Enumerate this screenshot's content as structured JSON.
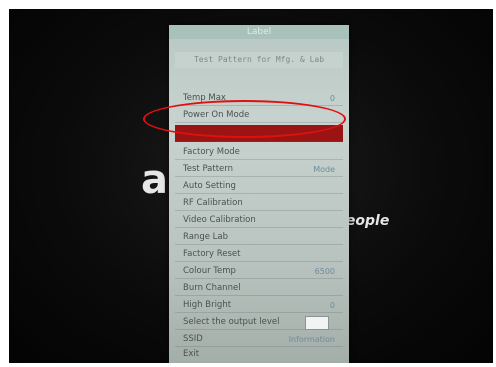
{
  "menu": {
    "title": "Label",
    "subtitle": "Test Pattern for Mfg. & Lab",
    "items": [
      {
        "label": "Temp Max",
        "value": "0"
      },
      {
        "label": "Power On Mode",
        "value": ""
      },
      {
        "label": "",
        "value": ""
      },
      {
        "label": "Factory Mode",
        "value": ""
      },
      {
        "label": "Test Pattern",
        "value": "Mode"
      },
      {
        "label": "Auto Setting",
        "value": ""
      },
      {
        "label": "RF Calibration",
        "value": ""
      },
      {
        "label": "Video Calibration",
        "value": ""
      },
      {
        "label": "Range Lab",
        "value": ""
      },
      {
        "label": "Factory Reset",
        "value": ""
      },
      {
        "label": "Colour Temp",
        "value": "6500"
      },
      {
        "label": "Burn Channel",
        "value": ""
      },
      {
        "label": "High Bright",
        "value": "0"
      },
      {
        "label": "Select the output level",
        "value": ""
      },
      {
        "label": "SSID",
        "value": "Information"
      },
      {
        "label": "Exit",
        "value": ""
      }
    ]
  },
  "background": {
    "logo_fragment": "a",
    "tagline_fragment": "People"
  },
  "colors": {
    "selected_row": "#9a1414",
    "annotation_oval": "#e01010"
  }
}
